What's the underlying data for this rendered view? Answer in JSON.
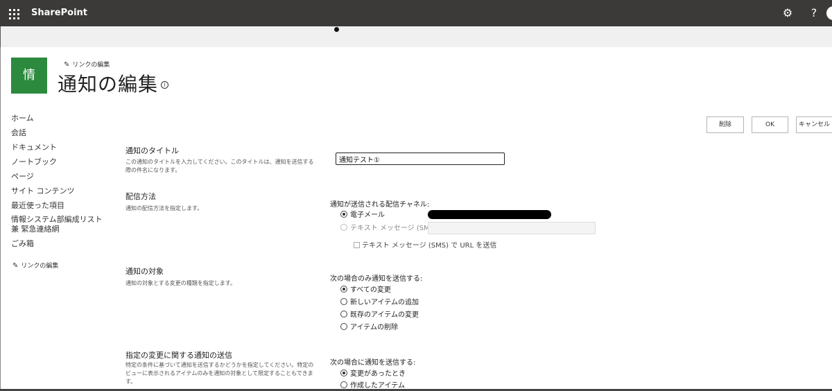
{
  "suite_bar": {
    "app_name": "SharePoint"
  },
  "header": {
    "site_logo_text": "情",
    "edit_link": "リンクの編集",
    "page_title": "通知の編集",
    "info_icon": "i"
  },
  "left_nav": {
    "items": [
      {
        "label": "ホーム"
      },
      {
        "label": "会話"
      },
      {
        "label": "ドキュメント"
      },
      {
        "label": "ノートブック"
      },
      {
        "label": "ページ"
      },
      {
        "label": "サイト コンテンツ"
      },
      {
        "label": "最近使った項目"
      },
      {
        "label": "情報システム部編成リスト 兼 緊急連絡網"
      },
      {
        "label": "ごみ箱"
      }
    ],
    "edit_link": "リンクの編集"
  },
  "actions": {
    "delete_label": "削除",
    "ok_label": "OK",
    "cancel_label": "キャンセル"
  },
  "form": {
    "alert_title": {
      "title": "通知のタイトル",
      "description": "この通知のタイトルを入力してください。このタイトルは、通知を送信する際の件名になります。",
      "value": "通知テスト①"
    },
    "delivery": {
      "title": "配信方法",
      "description": "通知の配信方法を指定します。",
      "channel_label": "通知が送信される配信チャネル:",
      "email_label": "電子メール",
      "email_checked": true,
      "sms_label": "テキスト メッセージ (SMS)",
      "sms_checked": false,
      "sms_url_label": "テキスト メッセージ (SMS) で URL を送信"
    },
    "change_type": {
      "title": "通知の対象",
      "description": "通知の対象とする変更の種類を指定します。",
      "label": "次の場合のみ通知を送信する:",
      "options": [
        {
          "label": "すべての変更",
          "checked": true
        },
        {
          "label": "新しいアイテムの追加",
          "checked": false
        },
        {
          "label": "既存のアイテムの変更",
          "checked": false
        },
        {
          "label": "アイテムの削除",
          "checked": false
        }
      ]
    },
    "filter": {
      "title": "指定の変更に関する通知の送信",
      "description": "特定の条件に基づいて通知を送信するかどうかを指定してください。特定のビューに表示されるアイテムのみを通知の対象として限定することもできます。",
      "label": "次の場合に通知を送信する:",
      "options": [
        {
          "label": "変更があったとき",
          "checked": true
        },
        {
          "label": "作成したアイテム",
          "checked": false
        }
      ]
    }
  },
  "colors": {
    "suite_bar": "#3b3a39",
    "site_logo": "#2b8a3e"
  },
  "icons": {
    "app_launcher": "waffle-icon",
    "settings": "gear-icon",
    "help": "help-icon",
    "edit": "pencil-icon",
    "info": "info-icon"
  }
}
